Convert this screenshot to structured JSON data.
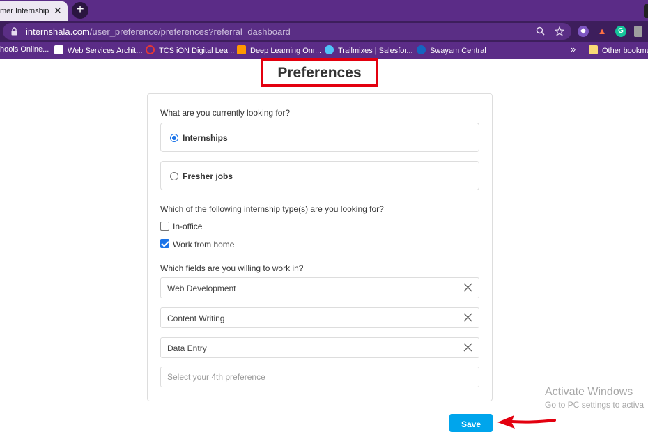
{
  "browser": {
    "tab_title": "mer Internship",
    "tab_close": "✕",
    "new_tab": "+",
    "url_host": "internshala.com",
    "url_path": "/user_preference/preferences?referral=dashboard",
    "bookmarks": [
      {
        "label": "hools Online...",
        "icon": "school-icon",
        "color": "#ffffff"
      },
      {
        "label": "Web Services Archit...",
        "icon": "w3-icon",
        "color": "#ffffff"
      },
      {
        "label": "TCS iON Digital Lea...",
        "icon": "tcs-icon",
        "color": "#e53935"
      },
      {
        "label": "Deep Learning Onr...",
        "icon": "deeplearning-icon",
        "color": "#ff9800"
      },
      {
        "label": "Trailmixes | Salesfor...",
        "icon": "trailhead-icon",
        "color": "#4fc3f7"
      },
      {
        "label": "Swayam Central",
        "icon": "swayam-icon",
        "color": "#1565c0"
      }
    ],
    "bookmarks_more": "»",
    "other_bookmarks": "Other bookma"
  },
  "page": {
    "title": "Preferences",
    "q1": "What are you currently looking for?",
    "options": [
      {
        "label": "Internships",
        "selected": true
      },
      {
        "label": "Fresher jobs",
        "selected": false
      }
    ],
    "q2": "Which of the following internship type(s) are you looking for?",
    "types": [
      {
        "label": "In-office",
        "checked": false
      },
      {
        "label": "Work from home",
        "checked": true
      }
    ],
    "q3": "Which fields are you willing to work in?",
    "fields": [
      "Web Development",
      "Content Writing",
      "Data Entry"
    ],
    "field4_placeholder": "Select your 4th preference",
    "save_label": "Save"
  },
  "watermark": {
    "line1": "Activate Windows",
    "line2": "Go to PC settings to activa"
  },
  "colors": {
    "accent": "#1a73e8",
    "save_button": "#00a5ec",
    "highlight": "#e3000f",
    "chrome": "#5b2c87"
  }
}
